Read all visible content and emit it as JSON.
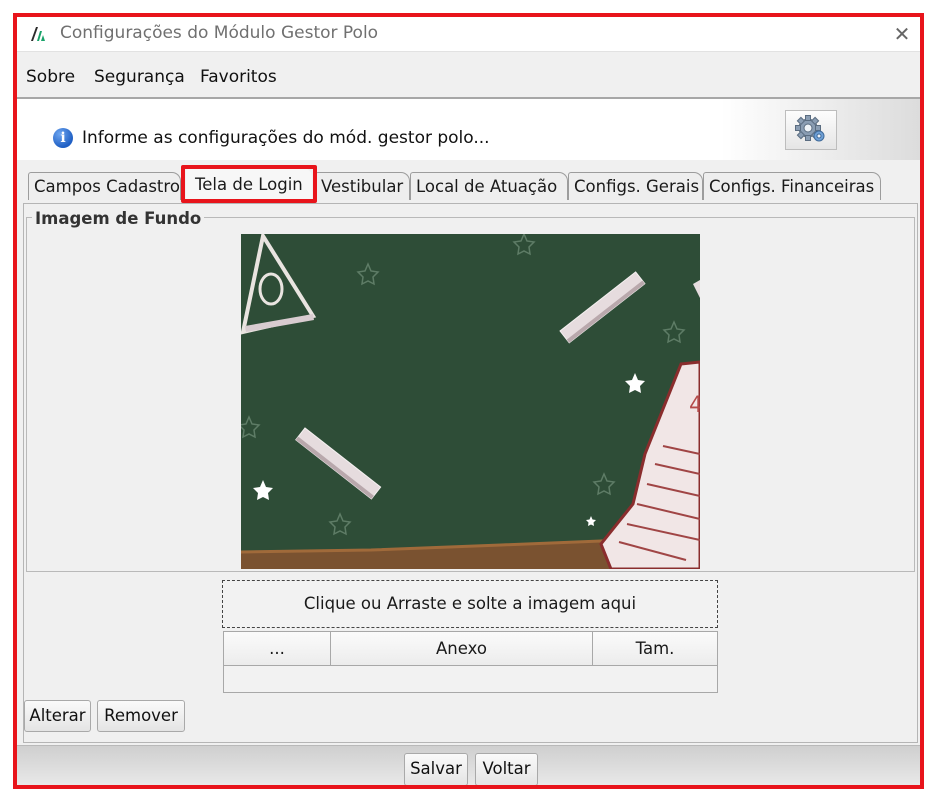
{
  "window": {
    "title": "Configurações do Módulo Gestor Polo",
    "close_glyph": "✕"
  },
  "menu": {
    "items": [
      "Sobre",
      "Segurança",
      "Favoritos"
    ]
  },
  "info": {
    "text": "Informe as configurações do mód. gestor polo...",
    "icon": "info-icon",
    "config_button_icon": "gears-icon"
  },
  "tabs": [
    {
      "label": "Campos Cadastro",
      "active": false
    },
    {
      "label": "Tela de Login",
      "active": true
    },
    {
      "label": "Vestibular",
      "active": false
    },
    {
      "label": "Local de Atuação",
      "active": false
    },
    {
      "label": "Configs. Gerais",
      "active": false
    },
    {
      "label": "Configs. Financeiras",
      "active": false
    }
  ],
  "background_section": {
    "legend": "Imagem de Fundo"
  },
  "dropzone": {
    "text": "Clique ou Arraste e solte a imagem aqui"
  },
  "attachments": {
    "columns": [
      "...",
      "Anexo",
      "Tam."
    ],
    "rows": []
  },
  "actions": {
    "change": "Alterar",
    "remove": "Remover"
  },
  "footer": {
    "save": "Salvar",
    "back": "Voltar"
  },
  "colors": {
    "annotation_red": "#e8141b",
    "chalkboard": "#2e4d37",
    "window_bg": "#f0f0f0"
  }
}
